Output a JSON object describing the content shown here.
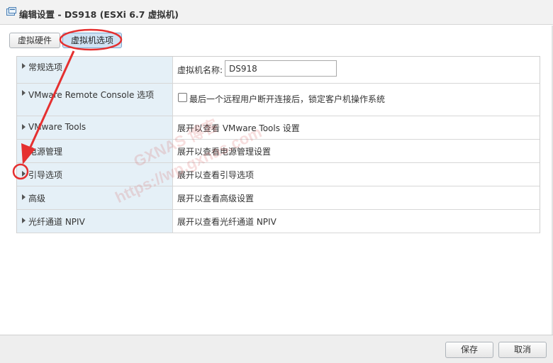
{
  "window": {
    "title": "编辑设置 - DS918 (ESXi 6.7 虚拟机)",
    "icon": "vm-settings-icon"
  },
  "tabs": [
    {
      "label": "虚拟硬件",
      "active": false
    },
    {
      "label": "虚拟机选项",
      "active": true
    }
  ],
  "options": {
    "general": {
      "label": "常规选项",
      "name_label": "虚拟机名称:",
      "name_value": "DS918"
    },
    "vmrc": {
      "label": "VMware Remote Console 选项",
      "checkbox_label": "最后一个远程用户断开连接后，锁定客户机操作系统",
      "checked": false
    },
    "tools": {
      "label": "VMware Tools",
      "summary": "展开以查看 VMware Tools 设置"
    },
    "power": {
      "label": "电源管理",
      "summary": "展开以查看电源管理设置"
    },
    "boot": {
      "label": "引导选项",
      "summary": "展开以查看引导选项"
    },
    "advanced": {
      "label": "高级",
      "summary": "展开以查看高级设置"
    },
    "npiv": {
      "label": "光纤通道 NPIV",
      "summary": "展开以查看光纤通道 NPIV"
    }
  },
  "footer": {
    "save_label": "保存",
    "cancel_label": "取消"
  },
  "watermark": {
    "line1": "GXNAS 博客",
    "line2": "https://wp.gxnas.com"
  },
  "colors": {
    "accent": "#cfe3f4",
    "annotation": "#e53030",
    "label_bg": "#e5f0f7"
  }
}
